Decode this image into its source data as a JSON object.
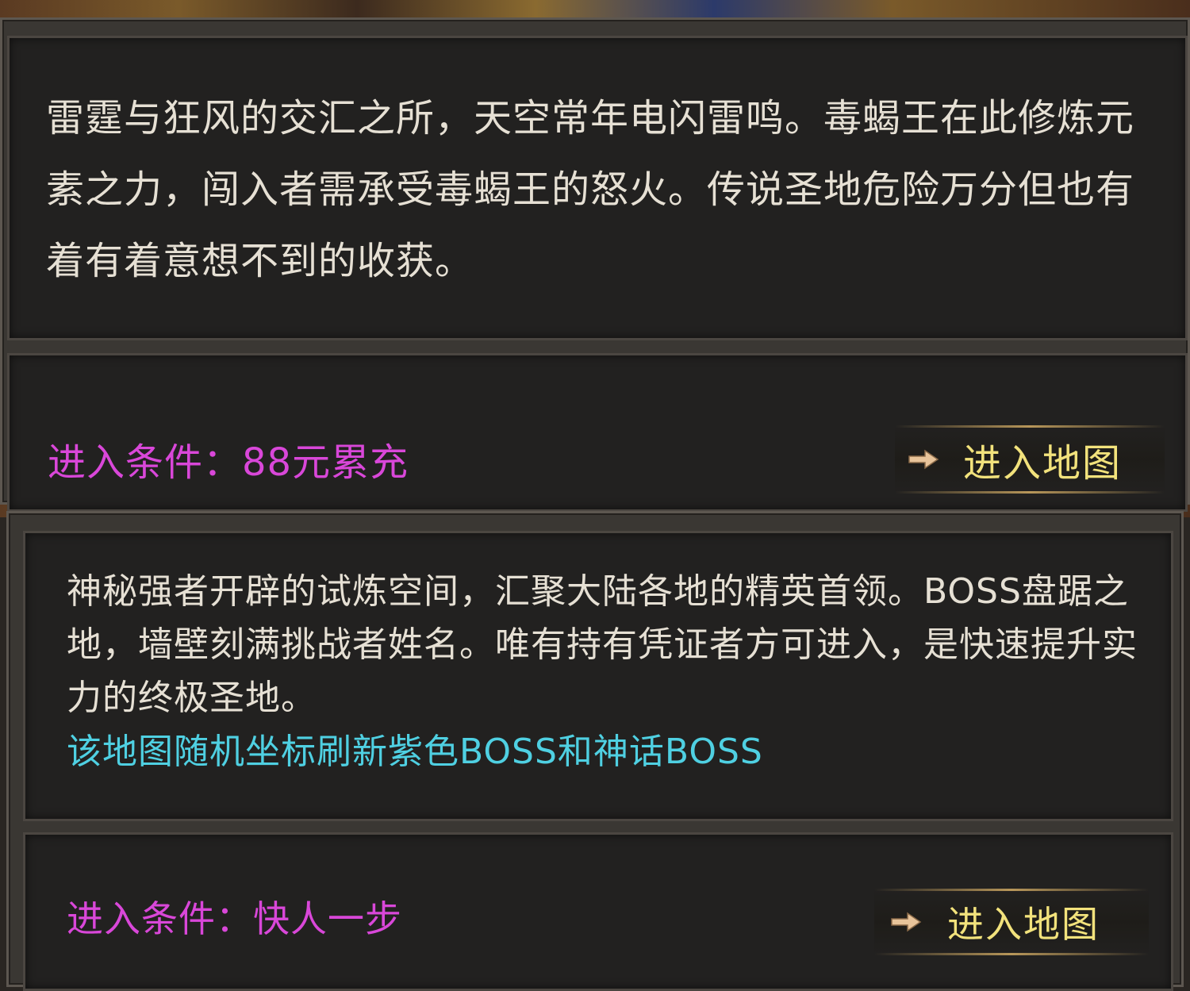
{
  "panels": [
    {
      "description": "雷霆与狂风的交汇之所，天空常年电闪雷鸣。毒蝎王在此修炼元素之力，闯入者需承受毒蝎王的怒火。传说圣地危险万分但也有着有着意想不到的收获。",
      "entry_condition": "进入条件：88元累充",
      "enter_button_label": "进入地图"
    },
    {
      "description": "神秘强者开辟的试炼空间，汇聚大陆各地的精英首领。BOSS盘踞之地，墙壁刻满挑战者姓名。唯有持有凭证者方可进入，是快速提升实力的终极圣地。",
      "highlight": "该地图随机坐标刷新紫色BOSS和神话BOSS",
      "entry_condition": "进入条件：快人一步",
      "enter_button_label": "进入地图"
    }
  ],
  "icons": {
    "enter_arrow": "arrow-right-icon"
  },
  "colors": {
    "description_text": "#e6e0d4",
    "condition_text": "#d947d9",
    "highlight_text": "#4fd0e2",
    "button_text": "#f2e27c"
  }
}
